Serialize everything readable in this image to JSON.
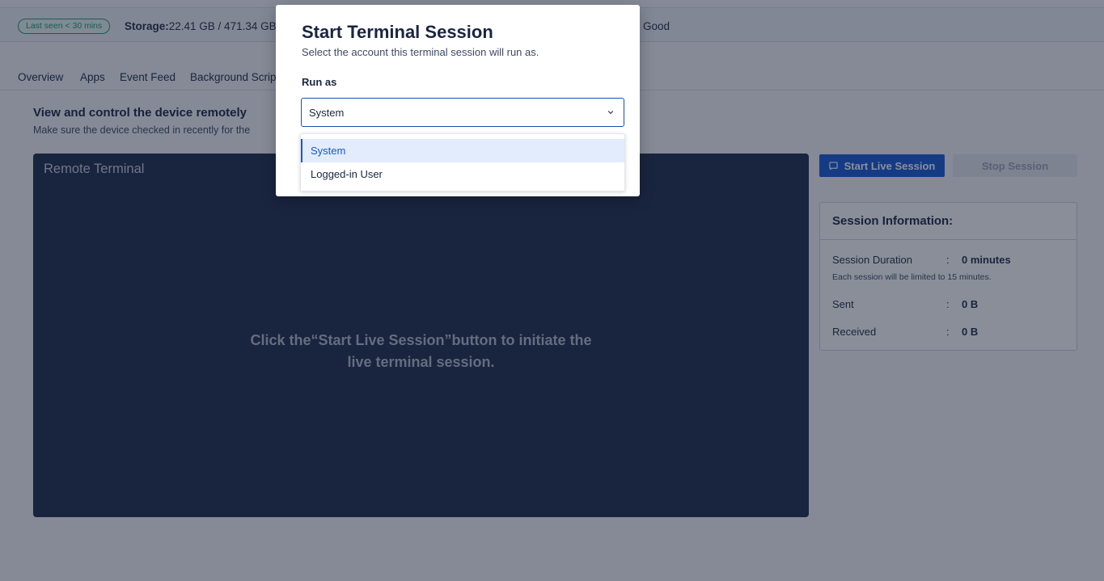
{
  "status_bar": {
    "badge": "Last seen < 30 mins",
    "storage_label": "Storage:",
    "storage_value": "22.41 GB / 471.34 GB",
    "health_value": "Good"
  },
  "tabs": [
    "Overview",
    "Apps",
    "Event Feed",
    "Background Scrip"
  ],
  "section": {
    "title": "View and control the device remotely",
    "subtitle": "Make sure the device checked in recently for the"
  },
  "terminal": {
    "title": "Remote Terminal",
    "message_line1": "Click the“Start Live Session”button to initiate the",
    "message_line2": "live terminal session."
  },
  "buttons": {
    "start_label": "Start Live Session",
    "stop_label": "Stop Session",
    "start_icon": "cast-icon"
  },
  "session_info": {
    "title": "Session Information:",
    "duration_label": "Session Duration",
    "duration_value": "0 minutes",
    "note": "Each session will be limited to 15 minutes.",
    "sent_label": "Sent",
    "sent_value": "0 B",
    "received_label": "Received",
    "received_value": "0 B",
    "separator": ":"
  },
  "modal": {
    "title": "Start Terminal Session",
    "subtitle": "Select the account this terminal session will run as.",
    "field_label": "Run as",
    "selected_value": "System",
    "options": [
      "System",
      "Logged-in User"
    ]
  },
  "colors": {
    "accent": "#1558d6",
    "terminal_bg": "#1c2a4a",
    "badge_green": "#1f9a73"
  }
}
